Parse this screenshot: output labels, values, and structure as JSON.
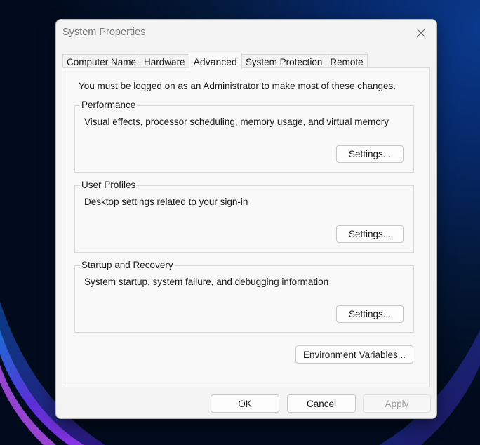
{
  "window": {
    "title": "System Properties",
    "close_icon": "close-icon"
  },
  "tabs": [
    {
      "label": "Computer Name",
      "active": false
    },
    {
      "label": "Hardware",
      "active": false
    },
    {
      "label": "Advanced",
      "active": true
    },
    {
      "label": "System Protection",
      "active": false
    },
    {
      "label": "Remote",
      "active": false
    }
  ],
  "advanced": {
    "admin_note": "You must be logged on as an Administrator to make most of these changes.",
    "groups": [
      {
        "legend": "Performance",
        "description": "Visual effects, processor scheduling, memory usage, and virtual memory",
        "button": "Settings..."
      },
      {
        "legend": "User Profiles",
        "description": "Desktop settings related to your sign-in",
        "button": "Settings..."
      },
      {
        "legend": "Startup and Recovery",
        "description": "System startup, system failure, and debugging information",
        "button": "Settings..."
      }
    ],
    "env_button": "Environment Variables..."
  },
  "footer": {
    "ok": "OK",
    "cancel": "Cancel",
    "apply": "Apply",
    "apply_enabled": false
  },
  "colors": {
    "window_bg": "#f3f3f3",
    "panel_bg": "#f9f9f9",
    "border": "#d9d9d9",
    "disabled_text": "#9b9b9b",
    "desktop_accent": "#6a2bd9"
  }
}
